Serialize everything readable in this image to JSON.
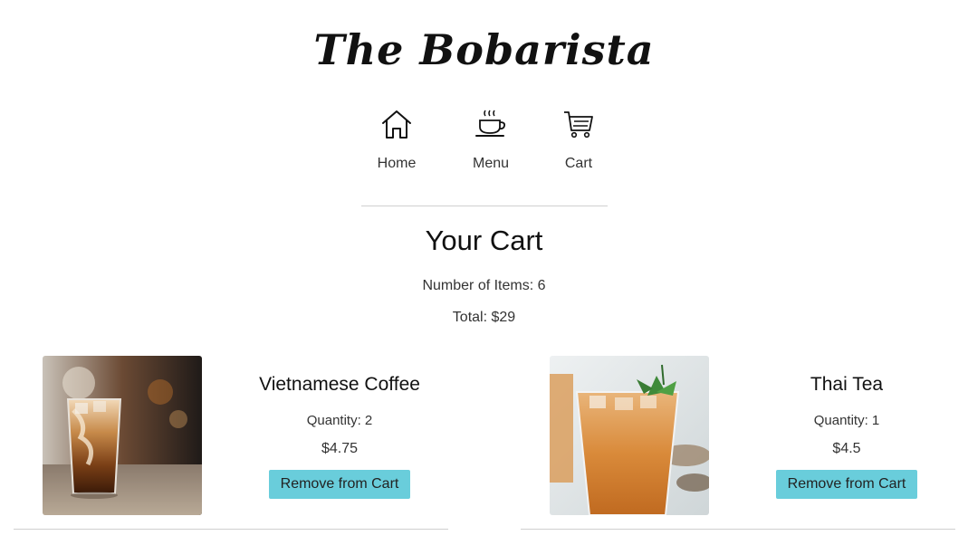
{
  "brand": {
    "title": "The Bobarista"
  },
  "nav": {
    "items": [
      {
        "label": "Home",
        "icon": "home-icon"
      },
      {
        "label": "Menu",
        "icon": "coffee-cup-icon"
      },
      {
        "label": "Cart",
        "icon": "shopping-cart-icon"
      }
    ]
  },
  "cart": {
    "title": "Your Cart",
    "count_text": "Number of Items: 6",
    "total_text": "Total: $29",
    "items": [
      {
        "name": "Vietnamese Coffee",
        "quantity_text": "Quantity: 2",
        "price": "$4.75",
        "remove_label": "Remove from Cart"
      },
      {
        "name": "Thai Tea",
        "quantity_text": "Quantity: 1",
        "price": "$4.5",
        "remove_label": "Remove from Cart"
      }
    ]
  },
  "colors": {
    "button_bg": "#69cddb",
    "divider": "#d0d0d0",
    "text": "#333333"
  }
}
